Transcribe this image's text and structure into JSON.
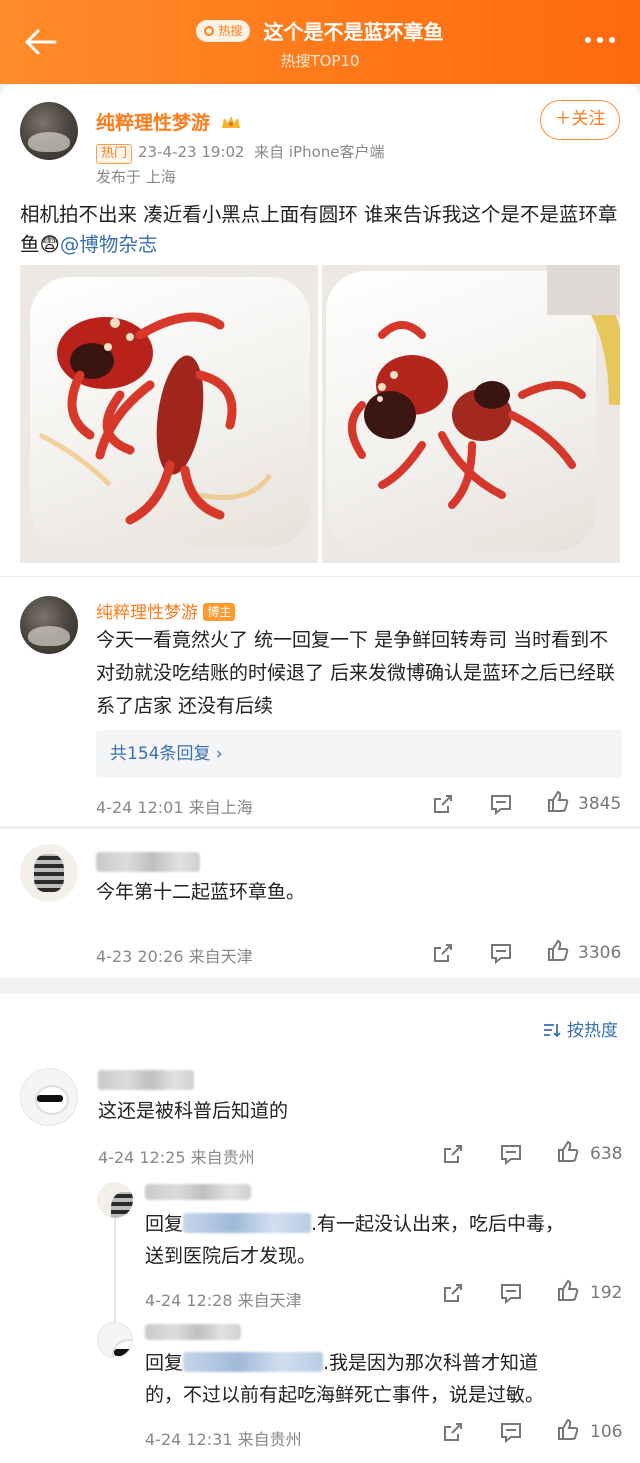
{
  "header": {
    "hot_badge": "热搜",
    "title": "这个是不是蓝环章鱼",
    "subtitle": "热搜TOP10"
  },
  "post": {
    "username": "纯粹理性梦游",
    "follow_label": "＋关注",
    "hot_tag": "热门",
    "date": "23-4-23 19:02",
    "source": "来自 iPhone客户端",
    "location": "发布于 上海",
    "text": "相机拍不出来 凑近看小黑点上面有圆环 谁来告诉我这个是不是蓝环章鱼😨",
    "mention": "@博物杂志"
  },
  "comments": [
    {
      "username": "纯粹理性梦游",
      "badge": "博主",
      "text": "今天一看竟然火了 统一回复一下 是争鲜回转寿司 当时看到不对劲就没吃结账的时候退了 后来发微博确认是蓝环之后已经联系了店家 还没有后续",
      "replies_label": "共154条回复 ›",
      "time": "4-24 12:01  来自上海",
      "likes": "3845"
    },
    {
      "text": "今年第十二起蓝环章鱼。",
      "time": "4-23 20:26  来自天津",
      "likes": "3306"
    }
  ],
  "sort_label": "按热度",
  "list": [
    {
      "text": "这还是被科普后知道的",
      "time": "4-24 12:25  来自贵州",
      "likes": "638"
    }
  ],
  "replies": [
    {
      "prefix": "回复",
      "text_a": ".有一起没认出来，吃后中毒，",
      "text_b": "送到医院后才发现。",
      "time": "4-24 12:28  来自天津",
      "likes": "192"
    },
    {
      "prefix": "回复",
      "text_a": ".我是因为那次科普才知道",
      "text_b": "的，不过以前有起吃海鲜死亡事件，说是过敏。",
      "time": "4-24 12:31  来自贵州",
      "likes": "106"
    }
  ],
  "colors": {
    "accent": "#ff7b1b",
    "link": "#3a6fb0"
  }
}
